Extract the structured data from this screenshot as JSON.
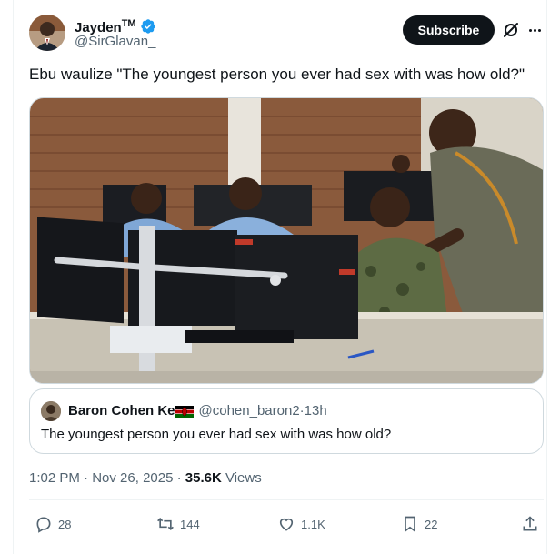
{
  "author": {
    "name": "Jayden",
    "name_suffix": "TM",
    "handle": "@SirGlavan_"
  },
  "subscribe_label": "Subscribe",
  "tweet_text": "Ebu waulize \"The youngest person you ever had sex with was how old?\"",
  "quoted": {
    "name": "Baron Cohen Ke",
    "handle": "@cohen_baron2",
    "separator": " · ",
    "time": "13h",
    "text": "The youngest person you ever had sex with was how old?"
  },
  "meta": {
    "time": "1:02 PM",
    "dot": " · ",
    "date": "Nov 26, 2025",
    "dot2": " · ",
    "views_count": "35.6K",
    "views_label": " Views"
  },
  "actions": {
    "replies": "28",
    "reposts": "144",
    "likes": "1.1K",
    "bookmarks": "22"
  },
  "icons": {
    "verified": "verified-badge-icon",
    "grok": "grok-icon",
    "more": "more-icon",
    "reply": "reply-icon",
    "repost": "repost-icon",
    "like": "heart-icon",
    "bookmark": "bookmark-icon",
    "share": "share-icon"
  },
  "colors": {
    "verified_blue": "#1d9bf0",
    "text_primary": "#0f1419",
    "text_secondary": "#536471",
    "border": "#cfd9de"
  }
}
